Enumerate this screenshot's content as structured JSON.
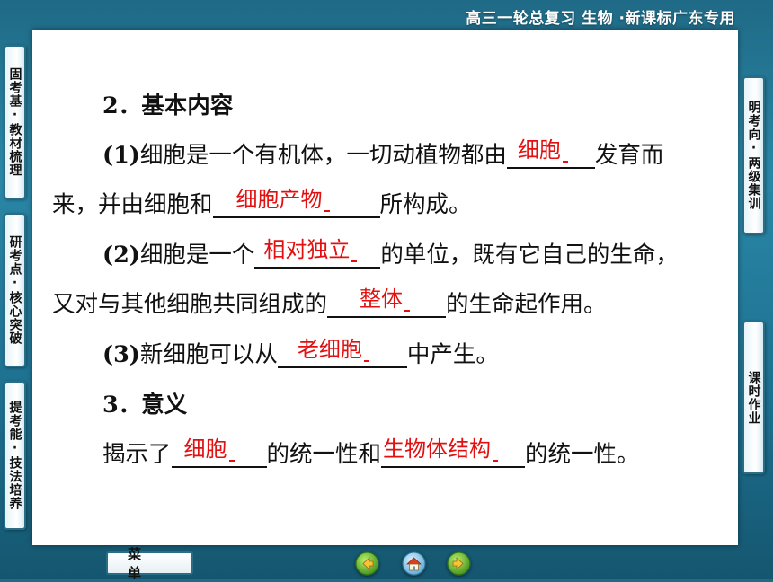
{
  "header": {
    "title": "高三一轮总复习 生物 ·新课标广东专用"
  },
  "left_tabs": [
    {
      "label": "固考基·教材梳理"
    },
    {
      "label": "研考点·核心突破"
    },
    {
      "label": "提考能·技法培养"
    }
  ],
  "right_tabs": [
    {
      "label": "明考向·两级集训"
    },
    {
      "label": "课时作业"
    }
  ],
  "content": {
    "section2_heading": "2．基本内容",
    "p1_num": "(1)",
    "p1_a": "细胞是一个有机体，一切动植物都由",
    "p1_blank1": "细胞",
    "p1_b": "发育而",
    "p1_c": "来，并由细胞和",
    "p1_blank2": "细胞产物",
    "p1_d": "所构成。",
    "p2_num": "(2)",
    "p2_a": "细胞是一个",
    "p2_blank1": "相对独立",
    "p2_b": "的单位，既有它自己的生命，",
    "p2_c": "又对与其他细胞共同组成的",
    "p2_blank2": "整体",
    "p2_d": "的生命起作用。",
    "p3_num": "(3)",
    "p3_a": "新细胞可以从",
    "p3_blank1": "老细胞",
    "p3_b": "中产生。",
    "section3_heading": "3．意义",
    "p4_a": "揭示了",
    "p4_blank1": "细胞",
    "p4_b": "的统一性和",
    "p4_blank2": "生物体结构",
    "p4_c": "的统一性。"
  },
  "footer": {
    "menu_label": "菜单",
    "nav_icons": [
      "previous-arrow-icon",
      "home-icon",
      "next-arrow-icon"
    ]
  },
  "colors": {
    "answer_red": "#e21010",
    "frame_teal": "#2a87a6",
    "tab_border": "#2a6d86"
  }
}
